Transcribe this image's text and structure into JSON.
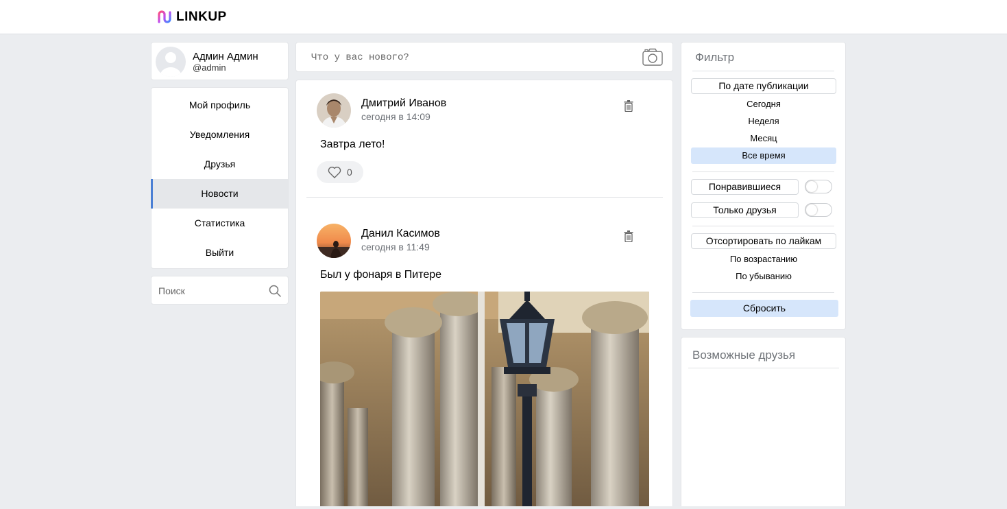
{
  "app": {
    "name": "LINKUP"
  },
  "user": {
    "name": "Админ Админ",
    "handle": "@admin"
  },
  "nav": {
    "items": [
      {
        "label": "Мой профиль"
      },
      {
        "label": "Уведомления"
      },
      {
        "label": "Друзья"
      },
      {
        "label": "Новости",
        "active": true
      },
      {
        "label": "Статистика"
      },
      {
        "label": "Выйти"
      }
    ]
  },
  "search": {
    "placeholder": "Поиск"
  },
  "compose": {
    "placeholder": "Что у вас нового?"
  },
  "posts": [
    {
      "author": "Дмитрий Иванов",
      "time": "сегодня в 14:09",
      "text": "Завтра лето!",
      "likes": "0"
    },
    {
      "author": "Данил Касимов",
      "time": "сегодня в 11:49",
      "text": "Был у фонаря в Питере",
      "has_image": true
    }
  ],
  "filter": {
    "title": "Фильтр",
    "date_button": "По дате публикации",
    "date_options": [
      "Сегодня",
      "Неделя",
      "Месяц",
      "Все время"
    ],
    "date_selected": "Все время",
    "liked_label": "Понравившиеся",
    "friends_only_label": "Только друзья",
    "sort_button": "Отсортировать по лайкам",
    "sort_options": [
      "По возрастанию",
      "По убыванию"
    ],
    "reset_label": "Сбросить"
  },
  "friends": {
    "title": "Возможные друзья"
  },
  "colors": {
    "accent": "#4a7fd4",
    "selected_bg": "#d6e6fb",
    "page_bg": "#ebedf0"
  }
}
